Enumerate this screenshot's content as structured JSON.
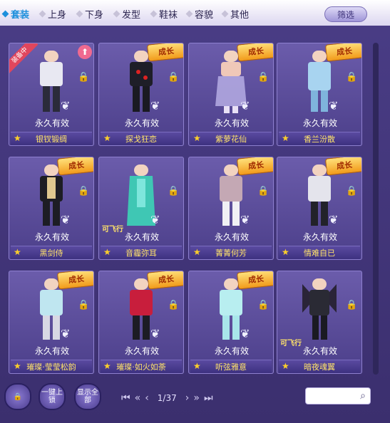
{
  "tabs": [
    {
      "label": "套装",
      "active": true
    },
    {
      "label": "上身",
      "active": false
    },
    {
      "label": "下身",
      "active": false
    },
    {
      "label": "发型",
      "active": false
    },
    {
      "label": "鞋袜",
      "active": false
    },
    {
      "label": "容貌",
      "active": false
    },
    {
      "label": "其他",
      "active": false
    }
  ],
  "filter_label": "筛选",
  "items": [
    {
      "duration": "永久有效",
      "name": "银钗锻绸",
      "badge": "装备中"
    },
    {
      "duration": "永久有效",
      "name": "探戈狂恋",
      "growth": "成长"
    },
    {
      "duration": "永久有效",
      "name": "紫萝花仙",
      "growth": "成长"
    },
    {
      "duration": "永久有效",
      "name": "香兰汾散",
      "growth": "成长"
    },
    {
      "duration": "永久有效",
      "name": "黑剑侍",
      "growth": "成长"
    },
    {
      "duration": "永久有效",
      "name": "音霾弥耳",
      "flyable": "可飞行"
    },
    {
      "duration": "永久有效",
      "name": "菁菁何芳",
      "growth": "成长"
    },
    {
      "duration": "永久有效",
      "name": "情难自已",
      "growth": "成长"
    },
    {
      "duration": "永久有效",
      "name": "璀璨·莹莹松韵",
      "growth": "成长"
    },
    {
      "duration": "永久有效",
      "name": "璀璨·如火如荼",
      "growth": "成长"
    },
    {
      "duration": "永久有效",
      "name": "听弦雅意",
      "growth": "成长"
    },
    {
      "duration": "永久有效",
      "name": "暗夜魂翼",
      "flyable": "可飞行"
    }
  ],
  "bottom": {
    "lock_all": "一键上锁",
    "show_all": "显示全部",
    "page": "1/37",
    "search_placeholder": ""
  },
  "colors": {
    "accent": "#1c8fdc",
    "name_text": "#ffe36a",
    "panel_bg": "#4a3d86"
  },
  "icons": [
    "lock-icon",
    "star-icon",
    "search-icon",
    "upgrade-arrow-icon",
    "wings-icon",
    "first-page-icon",
    "prev-fast-icon",
    "prev-page-icon",
    "next-page-icon",
    "next-fast-icon",
    "last-page-icon"
  ]
}
